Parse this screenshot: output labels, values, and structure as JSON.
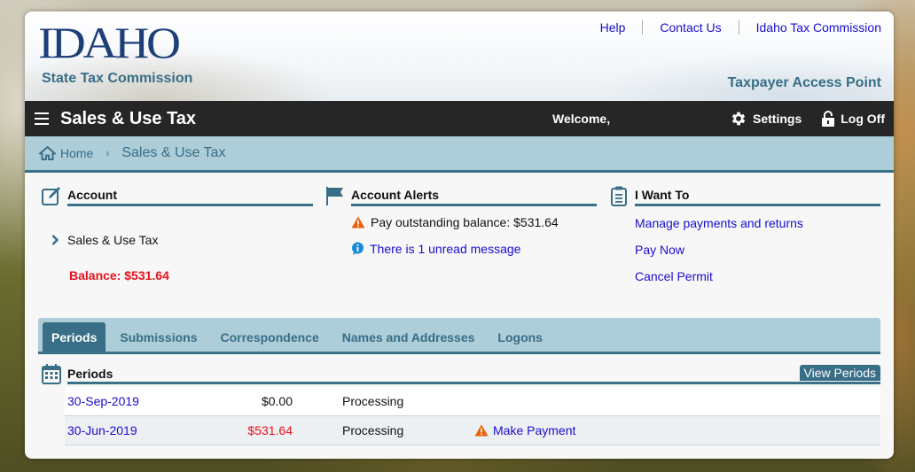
{
  "header": {
    "logo_text": "IDAHO",
    "logo_subtitle": "State Tax Commission",
    "top_links": [
      "Help",
      "Contact Us",
      "Idaho Tax Commission"
    ],
    "portal_name": "Taxpayer Access Point"
  },
  "navbar": {
    "title": "Sales & Use Tax",
    "welcome": "Welcome,",
    "settings_label": "Settings",
    "logoff_label": "Log Off"
  },
  "breadcrumb": {
    "home": "Home",
    "separator": "›",
    "current": "Sales & Use Tax"
  },
  "account": {
    "title": "Account",
    "item": "Sales & Use Tax",
    "balance": "Balance: $531.64"
  },
  "alerts": {
    "title": "Account Alerts",
    "items": [
      {
        "icon": "warning-icon",
        "text": "Pay outstanding balance: $531.64"
      },
      {
        "icon": "info-icon",
        "text": "There is 1 unread message"
      }
    ]
  },
  "want_to": {
    "title": "I Want To",
    "links": [
      "Manage payments and returns",
      "Pay Now",
      "Cancel Permit"
    ]
  },
  "tabs": [
    {
      "label": "Periods",
      "active": true
    },
    {
      "label": "Submissions",
      "active": false
    },
    {
      "label": "Correspondence",
      "active": false
    },
    {
      "label": "Names and Addresses",
      "active": false
    },
    {
      "label": "Logons",
      "active": false
    }
  ],
  "periods": {
    "title": "Periods",
    "view_button": "View Periods",
    "rows": [
      {
        "date": "30-Sep-2019",
        "amount": "$0.00",
        "amount_color": "#111111",
        "status": "Processing",
        "action": ""
      },
      {
        "date": "30-Jun-2019",
        "amount": "$531.64",
        "amount_color": "#e8101c",
        "status": "Processing",
        "action": "Make Payment"
      }
    ]
  },
  "colors": {
    "brand_teal": "#386e86",
    "navbar_bg": "#262626",
    "breadcrumb_bg": "#adcdd9",
    "link": "#1a0dcc",
    "alert_red": "#e8101c",
    "warning_orange": "#e8600c"
  }
}
